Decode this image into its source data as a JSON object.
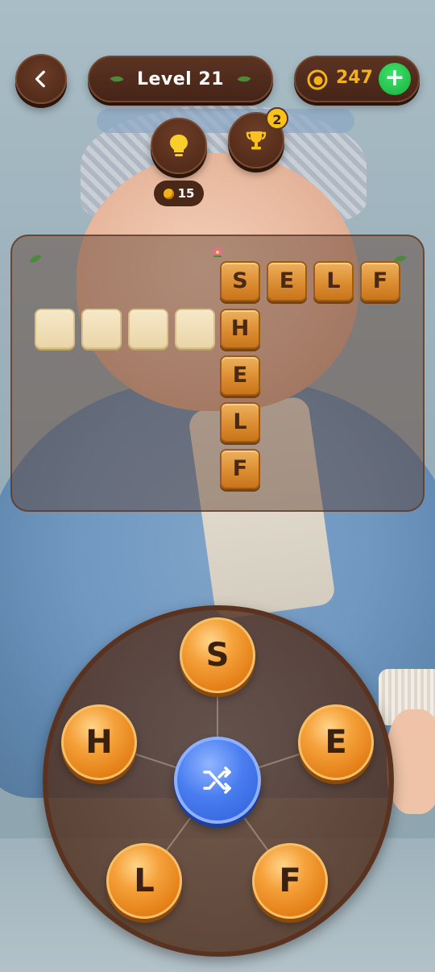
{
  "header": {
    "level_label": "Level 21",
    "coins": "247",
    "add_label": "+"
  },
  "hint": {
    "cost": "15"
  },
  "trophy": {
    "badge_count": "2"
  },
  "board": {
    "across_word": [
      "S",
      "E",
      "L",
      "F"
    ],
    "down_word": [
      "S",
      "H",
      "E",
      "L",
      "F"
    ],
    "empty_slots": 4
  },
  "wheel": {
    "letters": [
      "S",
      "E",
      "F",
      "L",
      "H"
    ]
  },
  "colors": {
    "wood_dark": "#4a2616",
    "coin_gold": "#f5b11a",
    "add_green": "#19b23f",
    "tile_orange": "#da8a2e",
    "shuffle_blue": "#2d5ed8"
  }
}
